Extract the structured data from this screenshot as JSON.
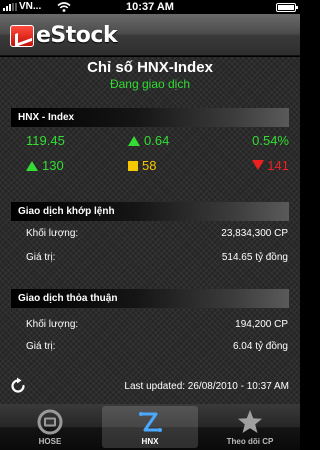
{
  "status_bar": {
    "carrier": "VN...",
    "time": "10:37 AM"
  },
  "app": {
    "logo_text": "eStock"
  },
  "page": {
    "title": "Chỉ số HNX-Index",
    "subtitle": "Đang giao dịch"
  },
  "index_section": {
    "header": "HNX - Index",
    "value": "119.45",
    "change": "0.64",
    "change_percent": "0.54%",
    "advances": "130",
    "unchanged": "58",
    "declines": "141",
    "colors": {
      "up": "#33dd33",
      "unchanged": "#f3c800",
      "down": "#ee2020"
    }
  },
  "matched_section": {
    "header": "Giao dịch khớp lệnh",
    "volume_label": "Khối lượng:",
    "volume_value": "23,834,300 CP",
    "value_label": "Giá trị:",
    "value_value": "514.65 tỷ đồng"
  },
  "negotiated_section": {
    "header": "Giao dịch thỏa thuận",
    "volume_label": "Khối lượng:",
    "volume_value": "194,200 CP",
    "value_label": "Giá trị:",
    "value_value": "6.04 tỷ đồng"
  },
  "footer": {
    "refresh_icon": "refresh-icon",
    "last_updated": "Last updated: 26/08/2010 - 10:37 AM"
  },
  "tab_bar": {
    "tabs": [
      {
        "label": "HOSE",
        "icon": "hose-icon",
        "active": false
      },
      {
        "label": "HNX",
        "icon": "hnx-icon",
        "active": true
      },
      {
        "label": "Theo dõi CP",
        "icon": "star-icon",
        "active": false
      }
    ]
  }
}
